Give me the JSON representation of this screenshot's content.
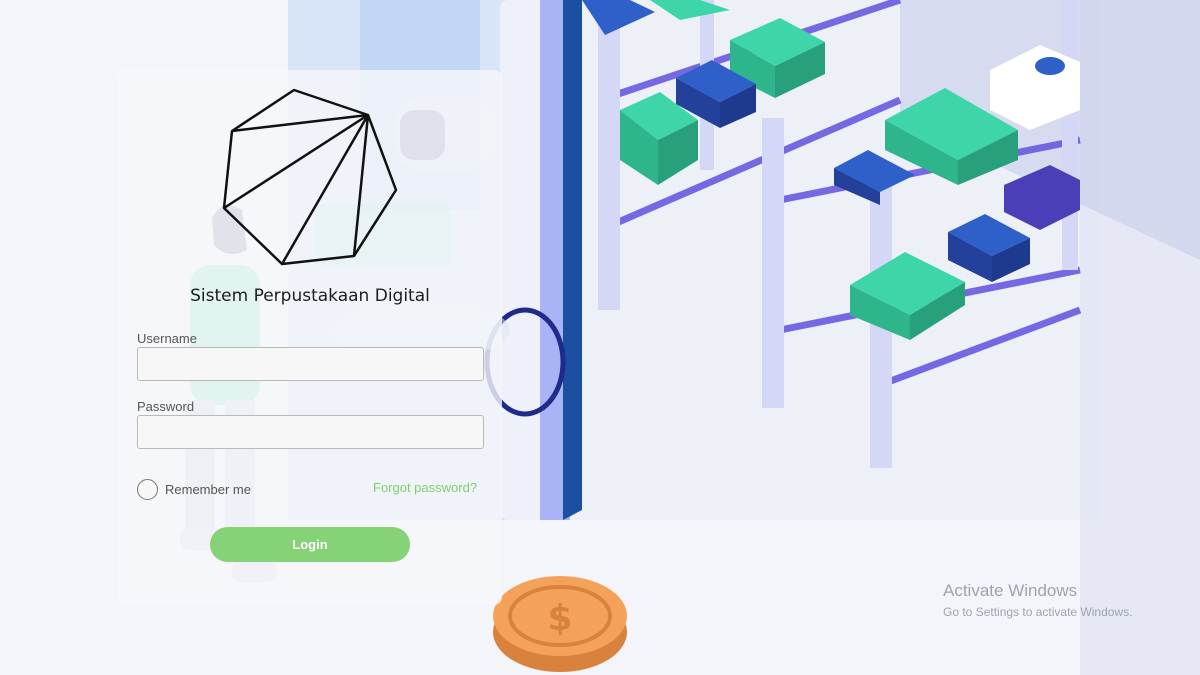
{
  "app": {
    "title": "Sistem Perpustakaan Digital"
  },
  "form": {
    "username_label": "Username",
    "username_value": "",
    "password_label": "Password",
    "password_value": "",
    "remember_label": "Remember me",
    "forgot_label": "Forgot password?",
    "login_label": "Login"
  },
  "watermark": {
    "title": "Activate Windows",
    "subtitle": "Go to Settings to activate Windows."
  },
  "colors": {
    "accent": "#86d377",
    "link": "#7fcf6a",
    "illustration_green": "#3ed6a8",
    "illustration_blue": "#2f5fc8",
    "illustration_purple": "#6a5ae0",
    "coin": "#f4a259"
  },
  "icons": {
    "logo": "heptagon-logo-icon",
    "coin": "dollar-coin-icon"
  }
}
